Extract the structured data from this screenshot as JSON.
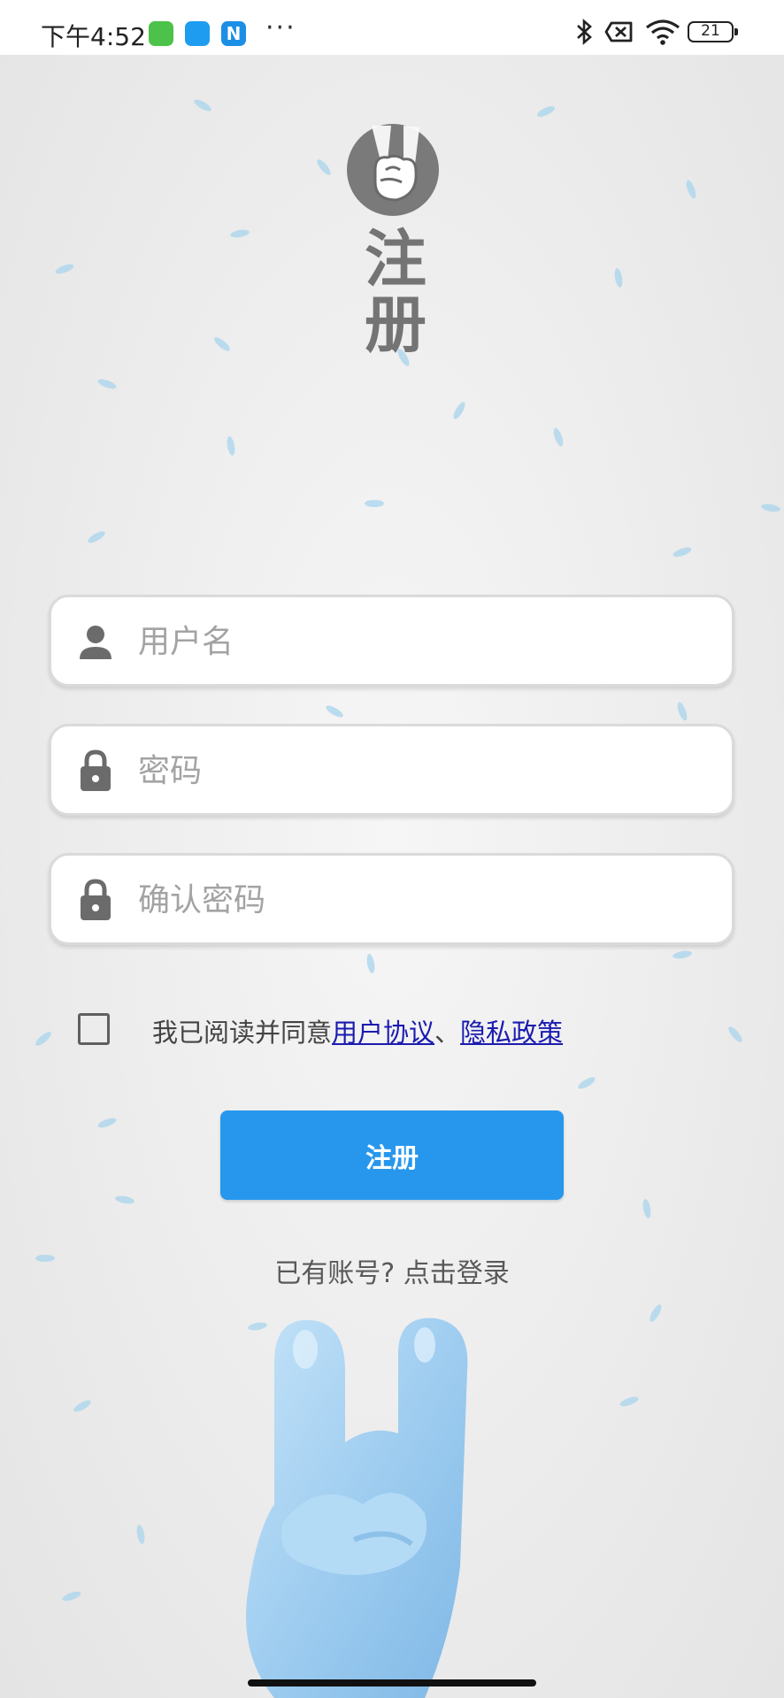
{
  "status_bar": {
    "time": "下午4:52",
    "battery": "21"
  },
  "logo": {
    "title": "注册"
  },
  "form": {
    "username_placeholder": "用户名",
    "password_placeholder": "密码",
    "confirm_placeholder": "确认密码",
    "agree_text": "我已阅读并同意",
    "user_agreement_link": "用户协议",
    "separator": "、",
    "privacy_link": "隐私政策",
    "submit_label": "注册",
    "login_link": "已有账号? 点击登录"
  },
  "colors": {
    "accent": "#2797ee",
    "link": "#1b1bb0",
    "hand": "#a9d3f3"
  }
}
